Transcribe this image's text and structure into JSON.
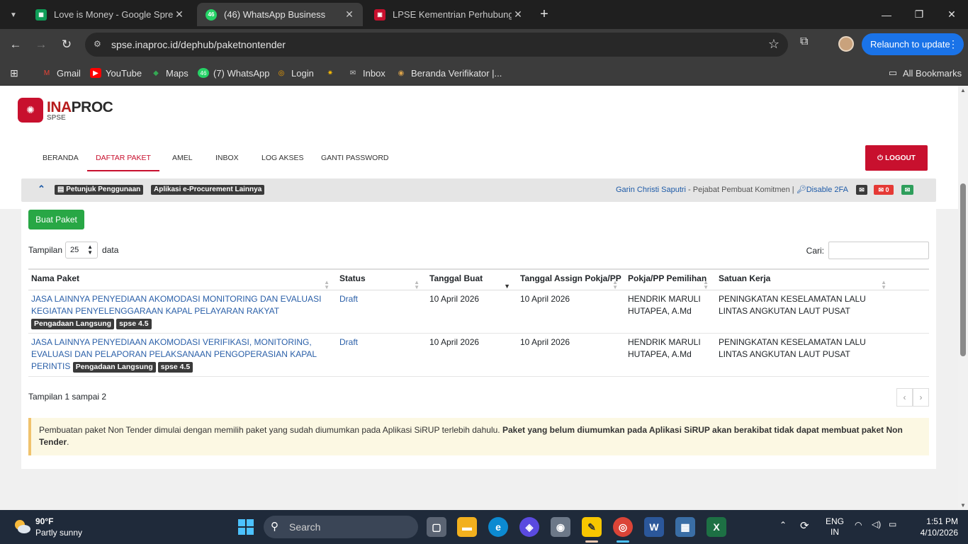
{
  "browser": {
    "tabs": [
      {
        "title": "Love is Money - Google Spread",
        "favicon_color": "#0f9d58",
        "active": false
      },
      {
        "title": "(46) WhatsApp Business",
        "favicon_badge": "46",
        "favicon_color": "#25d366",
        "active": true
      },
      {
        "title": "LPSE Kementrian Perhubungan",
        "favicon_color": "#c8102e",
        "active": false
      }
    ],
    "url": "spse.inaproc.id/dephub/paketnontender",
    "relaunch_label": "Relaunch to update",
    "bookmarks": [
      "Gmail",
      "YouTube",
      "Maps",
      "(7) WhatsApp",
      "Login",
      "",
      "Inbox",
      "Beranda Verifikator |..."
    ],
    "all_bookmarks": "All Bookmarks"
  },
  "header": {
    "logo_main": "INA",
    "logo_rest": "PROC",
    "logo_sub": "SPSE",
    "menu": [
      "BERANDA",
      "DAFTAR PAKET",
      "AMEL",
      "INBOX",
      "LOG AKSES",
      "GANTI PASSWORD"
    ],
    "active_menu": "DAFTAR PAKET",
    "logout": "LOGOUT"
  },
  "infobar": {
    "help": "Petunjuk Penggunaan",
    "other_apps": "Aplikasi e-Procurement Lainnya",
    "user_name": "Garin Christi Saputri",
    "user_role": " - Pejabat Pembuat Komitmen | ",
    "disable_2fa": "Disable 2FA",
    "mail_count": "0"
  },
  "content": {
    "create_button": "Buat Paket",
    "length_prefix": "Tampilan",
    "length_value": "25",
    "length_suffix": "data",
    "search_label": "Cari:",
    "columns": [
      "Nama Paket",
      "Status",
      "Tanggal Buat",
      "Tanggal Assign Pokja/PP",
      "Pokja/PP Pemilihan",
      "Satuan Kerja"
    ],
    "rows": [
      {
        "name": "JASA LAINNYA PENYEDIAAN AKOMODASI MONITORING DAN EVALUASI KEGIATAN PENYELENGGARAAN KAPAL PELAYARAN RAKYAT",
        "tags": [
          "Pengadaan Langsung",
          "spse 4.5"
        ],
        "status": "Draft",
        "created": "10 April 2026",
        "assigned": "10 April 2026",
        "pokja": "HENDRIK MARULI HUTAPEA, A.Md",
        "satker": "PENINGKATAN KESELAMATAN LALU LINTAS ANGKUTAN LAUT PUSAT"
      },
      {
        "name": "JASA LAINNYA PENYEDIAAN AKOMODASI VERIFIKASI, MONITORING, EVALUASI DAN PELAPORAN PELAKSANAAN PENGOPERASIAN KAPAL PERINTIS",
        "tags": [
          "Pengadaan Langsung",
          "spse 4.5"
        ],
        "status": "Draft",
        "created": "10 April 2026",
        "assigned": "10 April 2026",
        "pokja": "HENDRIK MARULI HUTAPEA, A.Md",
        "satker": "PENINGKATAN KESELAMATAN LALU LINTAS ANGKUTAN LAUT PUSAT"
      }
    ],
    "footer_info": "Tampilan 1 sampai 2",
    "pager_prev": "‹",
    "pager_next": "›",
    "alert_normal": "Pembuatan paket Non Tender dimulai dengan memilih paket yang sudah diumumkan pada Aplikasi SiRUP terlebih dahulu. ",
    "alert_bold": "Paket yang belum diumumkan pada Aplikasi SiRUP akan berakibat tidak dapat membuat paket Non Tender",
    "alert_end": "."
  },
  "taskbar": {
    "temperature": "90°F",
    "weather": "Partly sunny",
    "search_placeholder": "Search",
    "lang1": "ENG",
    "lang2": "IN",
    "time": "1:51 PM",
    "date": "4/10/2026"
  }
}
